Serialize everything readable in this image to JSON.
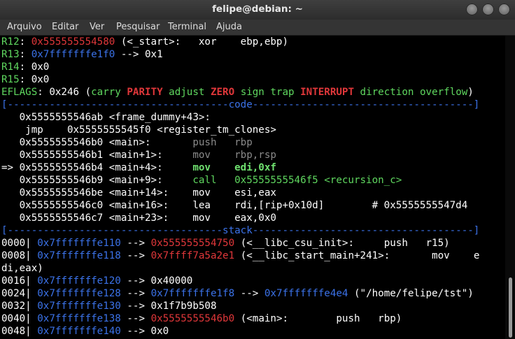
{
  "window": {
    "title": "felipe@debian: ~"
  },
  "menu": [
    "Arquivo",
    "Editar",
    "Ver",
    "Pesquisar",
    "Terminal",
    "Ajuda"
  ],
  "terminal": {
    "lines": [
      [
        [
          "R12",
          "g"
        ],
        [
          ": ",
          "w"
        ],
        [
          "0x555555554580",
          "r"
        ],
        [
          " (<_start>:\txor    ebp,ebp)",
          "w"
        ]
      ],
      [
        [
          "R13",
          "g"
        ],
        [
          ": ",
          "w"
        ],
        [
          "0x7fffffffe1f0",
          "b"
        ],
        [
          " --> 0x1",
          "w"
        ]
      ],
      [
        [
          "R14",
          "g"
        ],
        [
          ": 0x0",
          "w"
        ]
      ],
      [
        [
          "R15",
          "g"
        ],
        [
          ": 0x0",
          "w"
        ]
      ],
      [
        [
          "EFLAGS",
          "g"
        ],
        [
          ": 0x246 (",
          "w"
        ],
        [
          "carry ",
          "g"
        ],
        [
          "PARITY ",
          "rb"
        ],
        [
          "adjust ",
          "g"
        ],
        [
          "ZERO ",
          "rb"
        ],
        [
          "sign trap ",
          "g"
        ],
        [
          "INTERRUPT ",
          "rb"
        ],
        [
          "direction overflow",
          "g"
        ],
        [
          ")",
          "w"
        ]
      ],
      [
        [
          "[-------------------------------------code-------------------------------------]",
          "b"
        ]
      ],
      [
        [
          "   0x5555555546ab <frame_dummy+43>:",
          "w"
        ]
      ],
      [
        [
          "    jmp    0x5555555545f0 <register_tm_clones>",
          "w"
        ]
      ],
      [
        [
          "   0x5555555546b0 <main>:       ",
          "w"
        ],
        [
          "push   rbp",
          "dim"
        ]
      ],
      [
        [
          "   0x5555555546b1 <main+1>:     ",
          "w"
        ],
        [
          "mov    rbp,rsp",
          "dim"
        ]
      ],
      [
        [
          "=> 0x5555555546b4 <main+4>:     ",
          "w"
        ],
        [
          "mov    edi,0xf",
          "gb"
        ]
      ],
      [
        [
          "   0x5555555546b9 <main+9>:     ",
          "w"
        ],
        [
          "call   0x5555555546f5 <recursion_c>",
          "g"
        ]
      ],
      [
        [
          "   0x5555555546be <main+14>:    mov    esi,eax",
          "w"
        ]
      ],
      [
        [
          "   0x5555555546c0 <main+16>:    lea    rdi,[rip+0x10d]        # 0x5555555547d4",
          "w"
        ]
      ],
      [
        [
          "   0x5555555546c7 <main+23>:    mov    eax,0x0",
          "w"
        ]
      ],
      [
        [
          "[------------------------------------stack-------------------------------------]",
          "b"
        ]
      ],
      [
        [
          "0000| ",
          "w"
        ],
        [
          "0x7fffffffe110",
          "b"
        ],
        [
          " --> ",
          "w"
        ],
        [
          "0x555555554750",
          "r"
        ],
        [
          " (<__libc_csu_init>:     push   r15)",
          "w"
        ]
      ],
      [
        [
          "0008| ",
          "w"
        ],
        [
          "0x7fffffffe118",
          "b"
        ],
        [
          " --> ",
          "w"
        ],
        [
          "0x7ffff7a5a2e1",
          "r"
        ],
        [
          " (<__libc_start_main+241>:       mov    e",
          "w"
        ]
      ],
      [
        [
          "di,eax)",
          "w"
        ]
      ],
      [
        [
          "0016| ",
          "w"
        ],
        [
          "0x7fffffffe120",
          "b"
        ],
        [
          " --> 0x40000",
          "w"
        ]
      ],
      [
        [
          "0024| ",
          "w"
        ],
        [
          "0x7fffffffe128",
          "b"
        ],
        [
          " --> ",
          "w"
        ],
        [
          "0x7fffffffe1f8",
          "b"
        ],
        [
          " --> ",
          "w"
        ],
        [
          "0x7fffffffe4e4",
          "b"
        ],
        [
          " (\"/home/felipe/tst\")",
          "w"
        ]
      ],
      [
        [
          "0032| ",
          "w"
        ],
        [
          "0x7fffffffe130",
          "b"
        ],
        [
          " --> 0x1f7b9b508",
          "w"
        ]
      ],
      [
        [
          "0040| ",
          "w"
        ],
        [
          "0x7fffffffe138",
          "b"
        ],
        [
          " --> ",
          "w"
        ],
        [
          "0x5555555546b0",
          "r"
        ],
        [
          " (<main>:        push   rbp)",
          "w"
        ]
      ],
      [
        [
          "0048| ",
          "w"
        ],
        [
          "0x7fffffffe140",
          "b"
        ],
        [
          " --> 0x0",
          "w"
        ]
      ]
    ]
  }
}
